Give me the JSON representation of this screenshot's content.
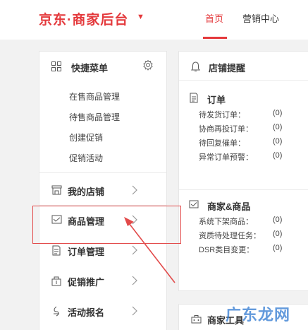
{
  "header": {
    "brand": "京东·商家后台",
    "nav": {
      "home": "首页",
      "marketing": "营销中心"
    }
  },
  "left_panel": {
    "quick_menu": {
      "title": "快捷菜单",
      "items": [
        "在售商品管理",
        "待售商品管理",
        "创建促销",
        "促销活动"
      ]
    },
    "menu": [
      {
        "label": "我的店铺",
        "icon": "store-icon"
      },
      {
        "label": "商品管理",
        "icon": "product-icon"
      },
      {
        "label": "订单管理",
        "icon": "order-icon"
      },
      {
        "label": "促销推广",
        "icon": "promotion-icon"
      },
      {
        "label": "活动报名",
        "icon": "activity-icon"
      }
    ]
  },
  "right_panel": {
    "title": "店铺提醒",
    "orders": {
      "title": "订单",
      "rows": [
        {
          "label": "待发货订单：",
          "value": "(0)"
        },
        {
          "label": "协商再投订单：",
          "value": "(0)"
        },
        {
          "label": "待回复催单：",
          "value": "(0)"
        },
        {
          "label": "异常订单预警：",
          "value": "(0)"
        }
      ]
    },
    "merchant": {
      "title": "商家&商品",
      "rows": [
        {
          "label": "系统下架商品：",
          "value": "(0)"
        },
        {
          "label": "资质待处理任务：",
          "value": "(0)"
        },
        {
          "label": "DSR类目变更：",
          "value": "(0)"
        }
      ]
    },
    "tools": {
      "title": "商家工具"
    }
  },
  "watermark": "广东龙网",
  "colors": {
    "accent": "#e4393c",
    "highlight": "#e24a4a"
  }
}
